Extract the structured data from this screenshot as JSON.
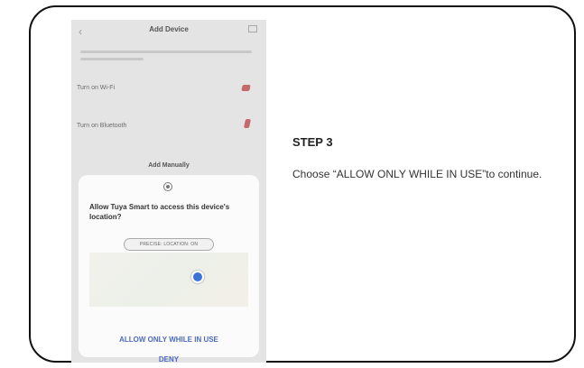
{
  "phone": {
    "title": "Add Device",
    "rows": [
      {
        "label": "Turn on Wi-Fi"
      },
      {
        "label": "Turn on Bluetooth"
      }
    ],
    "section_title": "Add Manually"
  },
  "dialog": {
    "message": "Allow Tuya Smart to access this device's location?",
    "precise_location": "PRECISE: LOCATION: ON",
    "allow_button": "ALLOW ONLY WHILE IN USE",
    "deny_button": "DENY"
  },
  "instructions": {
    "step_title": "STEP 3",
    "step_text": "Choose “ALLOW ONLY WHILE IN USE”to continue."
  },
  "colors": {
    "dialog_button": "#4b6bc0",
    "map_pin": "#3b72d8",
    "row_icon": "#c46a6a"
  }
}
